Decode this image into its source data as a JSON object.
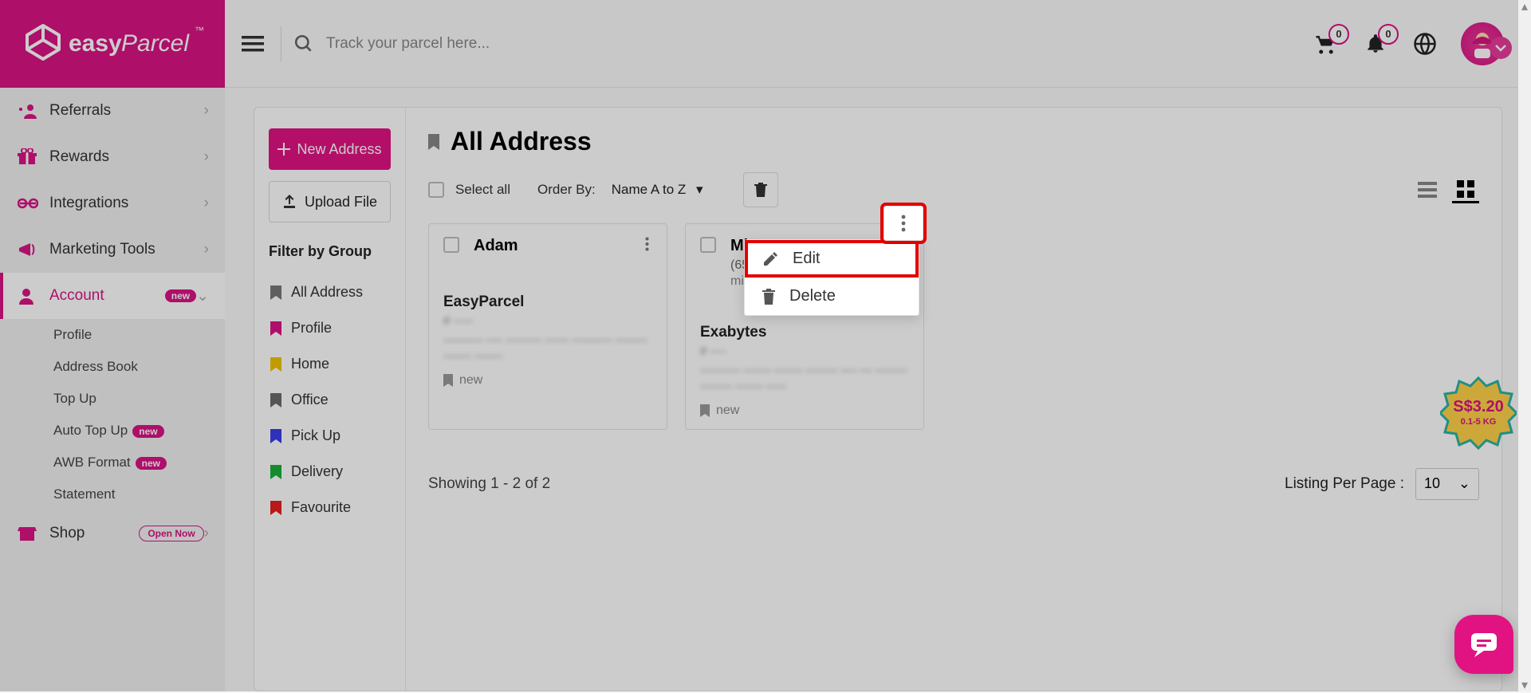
{
  "header": {
    "logo_main": "easy",
    "logo_accent": "Parcel",
    "search_placeholder": "Track your parcel here...",
    "cart_badge": "0",
    "bell_badge": "0"
  },
  "sidebar": {
    "items": [
      {
        "icon": "referrals",
        "label": "Referrals"
      },
      {
        "icon": "gift",
        "label": "Rewards"
      },
      {
        "icon": "link",
        "label": "Integrations"
      },
      {
        "icon": "megaphone",
        "label": "Marketing Tools"
      },
      {
        "icon": "user",
        "label": "Account",
        "badge": "new",
        "active": true
      },
      {
        "icon": "shop",
        "label": "Shop",
        "pill": "Open Now"
      }
    ],
    "account_sub": [
      {
        "label": "Profile"
      },
      {
        "label": "Address Book"
      },
      {
        "label": "Top Up"
      },
      {
        "label": "Auto Top Up",
        "badge": "new"
      },
      {
        "label": "AWB Format",
        "badge": "new"
      },
      {
        "label": "Statement"
      }
    ]
  },
  "left_col": {
    "new_address": "New Address",
    "upload_file": "Upload File",
    "filter_title": "Filter by Group",
    "groups": [
      {
        "color": "#777",
        "label": "All Address"
      },
      {
        "color": "#d91384",
        "label": "Profile"
      },
      {
        "color": "#f2c200",
        "label": "Home"
      },
      {
        "color": "#6b6b6b",
        "label": "Office"
      },
      {
        "color": "#3a3ee8",
        "label": "Pick Up"
      },
      {
        "color": "#1aaf3a",
        "label": "Delivery"
      },
      {
        "color": "#e62020",
        "label": "Favourite"
      }
    ]
  },
  "main": {
    "heading": "All Address",
    "select_all": "Select all",
    "order_by_label": "Order By:",
    "order_by_value": "Name A to Z",
    "showing": "Showing 1 - 2 of 2",
    "listing_label": "Listing Per Page :",
    "listing_value": "10"
  },
  "popup": {
    "edit": "Edit",
    "delete": "Delete"
  },
  "cards": [
    {
      "name": "Adam",
      "phone": "",
      "email": "",
      "company": "EasyParcel",
      "ref": "# -----",
      "addr": "---------- ---- --------- ------ ---------- -------- ------- -------",
      "tag": "new"
    },
    {
      "name": "Mira",
      "phone": "(65) --------",
      "email": "mira@easyparcel.com",
      "company": "Exabytes",
      "ref": "# ----",
      "addr": "---------- ------- ------- -------- ---- --- -------- -------- ------- -----",
      "tag": "new"
    }
  ],
  "promo": {
    "price": "S$3.20",
    "weight": "0.1-5 KG"
  }
}
